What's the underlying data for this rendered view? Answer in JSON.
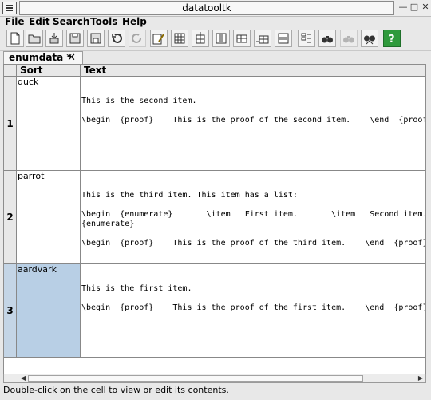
{
  "window": {
    "title": "datatooltk"
  },
  "menu": [
    "File",
    "Edit",
    "Search",
    "Tools",
    "Help"
  ],
  "toolbar": {
    "buttons": [
      {
        "icon": "new-file-icon"
      },
      {
        "icon": "open-folder-icon"
      },
      {
        "icon": "import-icon"
      },
      {
        "icon": "save-icon"
      },
      {
        "icon": "save-as-icon"
      },
      {
        "icon": "undo-icon"
      },
      {
        "icon": "redo-icon"
      },
      {
        "icon": "edit-cell-icon"
      },
      {
        "icon": "insert-column-icon"
      },
      {
        "icon": "add-column-icon"
      },
      {
        "icon": "remove-column-icon"
      },
      {
        "icon": "insert-row-icon"
      },
      {
        "icon": "add-row-icon"
      },
      {
        "icon": "remove-row-icon"
      },
      {
        "icon": "sort-icon"
      },
      {
        "icon": "find-icon"
      },
      {
        "icon": "find-next-icon"
      },
      {
        "icon": "replace-icon"
      },
      {
        "icon": "help-icon"
      }
    ]
  },
  "tab": {
    "label": "enumdata *",
    "close": "✕"
  },
  "table": {
    "columns": [
      "Sort",
      "Text"
    ],
    "rows": [
      {
        "num": "1",
        "sort": "duck",
        "text": [
          "This is the second item.",
          "",
          "\\begin  {proof}    This is the proof of the second item.    \\end  {proof}"
        ]
      },
      {
        "num": "2",
        "sort": "parrot",
        "text": [
          "This is the third item. This item has a list:",
          "",
          "\\begin  {enumerate}       \\item   First item.       \\item   Second item.     \\end",
          "{enumerate}",
          "",
          "\\begin  {proof}    This is the proof of the third item.    \\end  {proof}"
        ]
      },
      {
        "num": "3",
        "sort": "aardvark",
        "text": [
          "This is the first item.",
          "",
          "\\begin  {proof}    This is the proof of the first item.    \\end  {proof}"
        ]
      }
    ]
  },
  "status": "Double-click on the cell to view or edit its contents.",
  "colors": {
    "selection": "#b8cfe5",
    "header": "#e8e8e8",
    "toolbar_help": "#2f9a3c"
  }
}
